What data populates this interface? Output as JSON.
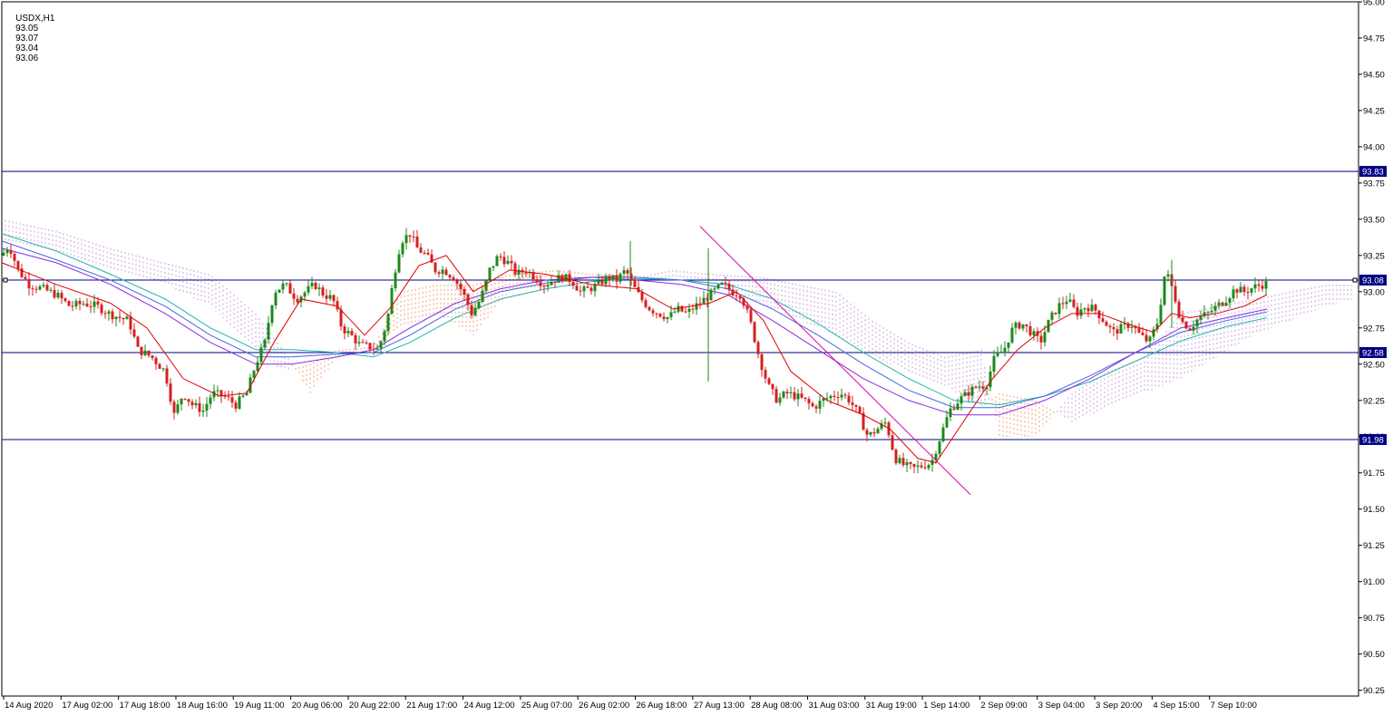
{
  "header": {
    "symbol": "USDX,H1",
    "open": "93.05",
    "high": "93.07",
    "low": "93.04",
    "close": "93.06"
  },
  "colors": {
    "background": "#ffffff",
    "bull_candle": "#1b8a1b",
    "bear_candle": "#d42020",
    "hline": "#000080",
    "ema_fast": "#e00000",
    "ma_purple": "#8a2be2",
    "ma_blue": "#4169e1",
    "ma_teal": "#20b2aa",
    "cloud_upper": "#c8a0d8",
    "cloud_lower": "#f0a070",
    "trendline": "#e000a0",
    "label_bg": "#000080"
  },
  "chart_data": {
    "type": "candlestick",
    "timeframe": "H1",
    "yaxis": {
      "ylim": [
        90.21,
        95.0
      ],
      "ticks": [
        "95.00",
        "94.75",
        "94.50",
        "94.25",
        "94.00",
        "93.75",
        "93.50",
        "93.25",
        "93.00",
        "92.75",
        "92.50",
        "92.25",
        "92.00",
        "91.75",
        "91.50",
        "91.25",
        "91.00",
        "90.75",
        "90.50",
        "90.25"
      ]
    },
    "xaxis": {
      "labels": [
        "14 Aug 2020",
        "17 Aug 02:00",
        "17 Aug 18:00",
        "18 Aug 16:00",
        "19 Aug 11:00",
        "20 Aug 06:00",
        "20 Aug 22:00",
        "21 Aug 17:00",
        "24 Aug 12:00",
        "25 Aug 07:00",
        "26 Aug 02:00",
        "26 Aug 18:00",
        "27 Aug 13:00",
        "28 Aug 08:00",
        "31 Aug 03:00",
        "31 Aug 19:00",
        "1 Sep 14:00",
        "2 Sep 09:00",
        "3 Sep 04:00",
        "3 Sep 20:00",
        "4 Sep 15:00",
        "7 Sep 10:00"
      ]
    },
    "horizontal_levels": [
      {
        "value": 93.83,
        "label": "93.83"
      },
      {
        "value": 93.08,
        "label": "93.08"
      },
      {
        "value": 92.58,
        "label": "92.58"
      },
      {
        "value": 91.98,
        "label": "91.98"
      }
    ],
    "price_path": [
      [
        0,
        93.25
      ],
      [
        8,
        93.32
      ],
      [
        18,
        93.15
      ],
      [
        30,
        93.05
      ],
      [
        45,
        93.02
      ],
      [
        60,
        92.98
      ],
      [
        75,
        92.9
      ],
      [
        90,
        92.92
      ],
      [
        105,
        92.9
      ],
      [
        118,
        92.85
      ],
      [
        130,
        92.82
      ],
      [
        140,
        92.8
      ],
      [
        150,
        92.6
      ],
      [
        165,
        92.55
      ],
      [
        180,
        92.45
      ],
      [
        190,
        92.15
      ],
      [
        200,
        92.3
      ],
      [
        210,
        92.22
      ],
      [
        222,
        92.18
      ],
      [
        232,
        92.3
      ],
      [
        245,
        92.28
      ],
      [
        258,
        92.22
      ],
      [
        270,
        92.3
      ],
      [
        280,
        92.5
      ],
      [
        290,
        92.65
      ],
      [
        300,
        93.0
      ],
      [
        312,
        93.05
      ],
      [
        325,
        92.95
      ],
      [
        335,
        93.0
      ],
      [
        345,
        93.05
      ],
      [
        355,
        92.98
      ],
      [
        365,
        92.95
      ],
      [
        375,
        92.75
      ],
      [
        385,
        92.7
      ],
      [
        395,
        92.63
      ],
      [
        405,
        92.62
      ],
      [
        415,
        92.6
      ],
      [
        425,
        92.8
      ],
      [
        432,
        93.1
      ],
      [
        440,
        93.35
      ],
      [
        450,
        93.4
      ],
      [
        458,
        93.3
      ],
      [
        468,
        93.25
      ],
      [
        478,
        93.15
      ],
      [
        488,
        93.15
      ],
      [
        498,
        93.1
      ],
      [
        508,
        93.0
      ],
      [
        518,
        92.85
      ],
      [
        528,
        92.95
      ],
      [
        538,
        93.15
      ],
      [
        548,
        93.25
      ],
      [
        558,
        93.2
      ],
      [
        568,
        93.12
      ],
      [
        578,
        93.15
      ],
      [
        588,
        93.1
      ],
      [
        598,
        93.05
      ],
      [
        608,
        93.08
      ],
      [
        618,
        93.1
      ],
      [
        628,
        93.08
      ],
      [
        638,
        93.0
      ],
      [
        648,
        93.02
      ],
      [
        658,
        93.05
      ],
      [
        668,
        93.1
      ],
      [
        678,
        93.08
      ],
      [
        688,
        93.15
      ],
      [
        695,
        93.05
      ],
      [
        705,
        92.95
      ],
      [
        715,
        92.88
      ],
      [
        725,
        92.85
      ],
      [
        735,
        92.82
      ],
      [
        745,
        92.88
      ],
      [
        755,
        92.85
      ],
      [
        765,
        92.9
      ],
      [
        775,
        92.95
      ],
      [
        785,
        93.0
      ],
      [
        795,
        93.05
      ],
      [
        805,
        93.0
      ],
      [
        815,
        92.98
      ],
      [
        825,
        92.8
      ],
      [
        835,
        92.55
      ],
      [
        845,
        92.35
      ],
      [
        855,
        92.25
      ],
      [
        865,
        92.3
      ],
      [
        875,
        92.28
      ],
      [
        885,
        92.25
      ],
      [
        895,
        92.2
      ],
      [
        905,
        92.25
      ],
      [
        915,
        92.28
      ],
      [
        925,
        92.3
      ],
      [
        935,
        92.25
      ],
      [
        945,
        92.15
      ],
      [
        955,
        92.0
      ],
      [
        965,
        92.05
      ],
      [
        975,
        92.1
      ],
      [
        985,
        91.85
      ],
      [
        995,
        91.8
      ],
      [
        1005,
        91.78
      ],
      [
        1015,
        91.8
      ],
      [
        1025,
        91.82
      ],
      [
        1035,
        92.0
      ],
      [
        1045,
        92.18
      ],
      [
        1055,
        92.25
      ],
      [
        1065,
        92.3
      ],
      [
        1075,
        92.35
      ],
      [
        1085,
        92.35
      ],
      [
        1095,
        92.55
      ],
      [
        1105,
        92.6
      ],
      [
        1115,
        92.75
      ],
      [
        1125,
        92.78
      ],
      [
        1135,
        92.72
      ],
      [
        1145,
        92.65
      ],
      [
        1155,
        92.8
      ],
      [
        1165,
        92.9
      ],
      [
        1175,
        92.95
      ],
      [
        1185,
        92.85
      ],
      [
        1195,
        92.9
      ],
      [
        1205,
        92.88
      ],
      [
        1215,
        92.8
      ],
      [
        1225,
        92.72
      ],
      [
        1235,
        92.75
      ],
      [
        1245,
        92.78
      ],
      [
        1255,
        92.7
      ],
      [
        1265,
        92.65
      ],
      [
        1275,
        92.8
      ],
      [
        1283,
        93.15
      ],
      [
        1292,
        93.0
      ],
      [
        1300,
        92.8
      ],
      [
        1310,
        92.75
      ],
      [
        1320,
        92.82
      ],
      [
        1330,
        92.85
      ],
      [
        1340,
        92.9
      ],
      [
        1350,
        92.95
      ],
      [
        1360,
        93.02
      ],
      [
        1370,
        93.0
      ],
      [
        1380,
        93.03
      ],
      [
        1390,
        93.05
      ],
      [
        1397,
        93.06
      ]
    ],
    "spike_candles": [
      {
        "i": 779,
        "high": 93.3,
        "low": 92.38
      },
      {
        "i": 1290,
        "high": 93.22,
        "low": 92.75
      },
      {
        "i": 693,
        "high": 93.35,
        "low": 93.0
      }
    ],
    "ema_fast": [
      [
        0,
        93.2
      ],
      [
        60,
        93.05
      ],
      [
        120,
        92.92
      ],
      [
        160,
        92.75
      ],
      [
        200,
        92.4
      ],
      [
        240,
        92.28
      ],
      [
        270,
        92.3
      ],
      [
        300,
        92.65
      ],
      [
        330,
        92.95
      ],
      [
        370,
        92.9
      ],
      [
        400,
        92.7
      ],
      [
        430,
        92.9
      ],
      [
        460,
        93.18
      ],
      [
        490,
        93.25
      ],
      [
        520,
        93.0
      ],
      [
        560,
        93.15
      ],
      [
        600,
        93.12
      ],
      [
        650,
        93.05
      ],
      [
        700,
        93.02
      ],
      [
        740,
        92.88
      ],
      [
        780,
        92.92
      ],
      [
        810,
        93.0
      ],
      [
        840,
        92.8
      ],
      [
        870,
        92.45
      ],
      [
        910,
        92.25
      ],
      [
        950,
        92.15
      ],
      [
        980,
        92.05
      ],
      [
        1010,
        91.85
      ],
      [
        1030,
        91.82
      ],
      [
        1060,
        92.1
      ],
      [
        1090,
        92.38
      ],
      [
        1120,
        92.6
      ],
      [
        1150,
        92.75
      ],
      [
        1180,
        92.85
      ],
      [
        1210,
        92.85
      ],
      [
        1240,
        92.78
      ],
      [
        1270,
        92.72
      ],
      [
        1290,
        92.85
      ],
      [
        1310,
        92.82
      ],
      [
        1340,
        92.85
      ],
      [
        1370,
        92.9
      ],
      [
        1395,
        92.98
      ]
    ],
    "ma_purple": [
      [
        0,
        93.3
      ],
      [
        60,
        93.2
      ],
      [
        120,
        93.05
      ],
      [
        180,
        92.85
      ],
      [
        230,
        92.65
      ],
      [
        280,
        92.5
      ],
      [
        320,
        92.5
      ],
      [
        370,
        92.55
      ],
      [
        410,
        92.6
      ],
      [
        450,
        92.75
      ],
      [
        500,
        92.92
      ],
      [
        550,
        93.02
      ],
      [
        600,
        93.08
      ],
      [
        650,
        93.1
      ],
      [
        700,
        93.08
      ],
      [
        750,
        93.05
      ],
      [
        800,
        92.98
      ],
      [
        850,
        92.8
      ],
      [
        900,
        92.6
      ],
      [
        950,
        92.4
      ],
      [
        1000,
        92.25
      ],
      [
        1050,
        92.15
      ],
      [
        1100,
        92.15
      ],
      [
        1150,
        92.25
      ],
      [
        1200,
        92.4
      ],
      [
        1250,
        92.58
      ],
      [
        1300,
        92.75
      ],
      [
        1350,
        92.82
      ],
      [
        1395,
        92.88
      ]
    ],
    "ma_blue": [
      [
        0,
        93.35
      ],
      [
        60,
        93.22
      ],
      [
        120,
        93.08
      ],
      [
        180,
        92.9
      ],
      [
        230,
        92.7
      ],
      [
        280,
        92.55
      ],
      [
        320,
        92.55
      ],
      [
        370,
        92.57
      ],
      [
        410,
        92.58
      ],
      [
        450,
        92.7
      ],
      [
        500,
        92.88
      ],
      [
        550,
        93.0
      ],
      [
        600,
        93.06
      ],
      [
        650,
        93.1
      ],
      [
        700,
        93.1
      ],
      [
        750,
        93.08
      ],
      [
        800,
        93.02
      ],
      [
        850,
        92.88
      ],
      [
        900,
        92.7
      ],
      [
        950,
        92.5
      ],
      [
        1000,
        92.32
      ],
      [
        1050,
        92.2
      ],
      [
        1100,
        92.2
      ],
      [
        1150,
        92.28
      ],
      [
        1200,
        92.42
      ],
      [
        1250,
        92.58
      ],
      [
        1300,
        92.72
      ],
      [
        1350,
        92.8
      ],
      [
        1395,
        92.86
      ]
    ],
    "ma_teal": [
      [
        0,
        93.4
      ],
      [
        60,
        93.28
      ],
      [
        120,
        93.12
      ],
      [
        180,
        92.95
      ],
      [
        230,
        92.75
      ],
      [
        280,
        92.6
      ],
      [
        320,
        92.6
      ],
      [
        370,
        92.58
      ],
      [
        410,
        92.55
      ],
      [
        450,
        92.65
      ],
      [
        500,
        92.82
      ],
      [
        550,
        92.95
      ],
      [
        600,
        93.02
      ],
      [
        650,
        93.07
      ],
      [
        700,
        93.09
      ],
      [
        750,
        93.08
      ],
      [
        800,
        93.05
      ],
      [
        850,
        92.95
      ],
      [
        900,
        92.78
      ],
      [
        950,
        92.58
      ],
      [
        1000,
        92.4
      ],
      [
        1050,
        92.25
      ],
      [
        1100,
        92.22
      ],
      [
        1150,
        92.28
      ],
      [
        1200,
        92.38
      ],
      [
        1250,
        92.52
      ],
      [
        1300,
        92.66
      ],
      [
        1350,
        92.76
      ],
      [
        1395,
        92.82
      ]
    ],
    "cloud": [
      {
        "i": 0,
        "a": 93.5,
        "b": 93.35
      },
      {
        "i": 60,
        "a": 93.42,
        "b": 93.28
      },
      {
        "i": 120,
        "a": 93.3,
        "b": 93.15
      },
      {
        "i": 180,
        "a": 93.2,
        "b": 93.05
      },
      {
        "i": 230,
        "a": 93.12,
        "b": 92.9
      },
      {
        "i": 280,
        "a": 92.85,
        "b": 92.6
      },
      {
        "i": 310,
        "a": 92.6,
        "b": 92.45
      },
      {
        "i": 340,
        "a": 92.3,
        "b": 92.5
      },
      {
        "i": 370,
        "a": 92.55,
        "b": 92.6
      },
      {
        "i": 410,
        "a": 92.6,
        "b": 92.62
      },
      {
        "i": 440,
        "a": 92.75,
        "b": 93.0
      },
      {
        "i": 480,
        "a": 92.85,
        "b": 93.05
      },
      {
        "i": 520,
        "a": 92.7,
        "b": 93.05
      },
      {
        "i": 560,
        "a": 93.0,
        "b": 93.12
      },
      {
        "i": 610,
        "a": 93.05,
        "b": 93.15
      },
      {
        "i": 660,
        "a": 93.1,
        "b": 93.12
      },
      {
        "i": 700,
        "a": 93.1,
        "b": 93.1
      },
      {
        "i": 740,
        "a": 93.15,
        "b": 93.08
      },
      {
        "i": 790,
        "a": 93.12,
        "b": 93.05
      },
      {
        "i": 840,
        "a": 93.1,
        "b": 92.9
      },
      {
        "i": 880,
        "a": 93.05,
        "b": 92.8
      },
      {
        "i": 920,
        "a": 93.0,
        "b": 92.7
      },
      {
        "i": 960,
        "a": 92.8,
        "b": 92.55
      },
      {
        "i": 1000,
        "a": 92.65,
        "b": 92.45
      },
      {
        "i": 1040,
        "a": 92.55,
        "b": 92.35
      },
      {
        "i": 1080,
        "a": 92.6,
        "b": 92.2
      },
      {
        "i": 1100,
        "a": 92.0,
        "b": 92.3
      },
      {
        "i": 1140,
        "a": 92.0,
        "b": 92.25
      },
      {
        "i": 1180,
        "a": 92.3,
        "b": 92.1
      },
      {
        "i": 1220,
        "a": 92.45,
        "b": 92.2
      },
      {
        "i": 1260,
        "a": 92.55,
        "b": 92.3
      },
      {
        "i": 1300,
        "a": 92.85,
        "b": 92.4
      },
      {
        "i": 1340,
        "a": 92.9,
        "b": 92.55
      },
      {
        "i": 1380,
        "a": 92.95,
        "b": 92.7
      },
      {
        "i": 1420,
        "a": 93.0,
        "b": 92.8
      },
      {
        "i": 1460,
        "a": 93.05,
        "b": 92.9
      },
      {
        "i": 1490,
        "a": 93.05,
        "b": 92.95
      }
    ],
    "trendline": {
      "x1": 770,
      "y1": 93.45,
      "x2": 1068,
      "y2": 91.6
    }
  }
}
